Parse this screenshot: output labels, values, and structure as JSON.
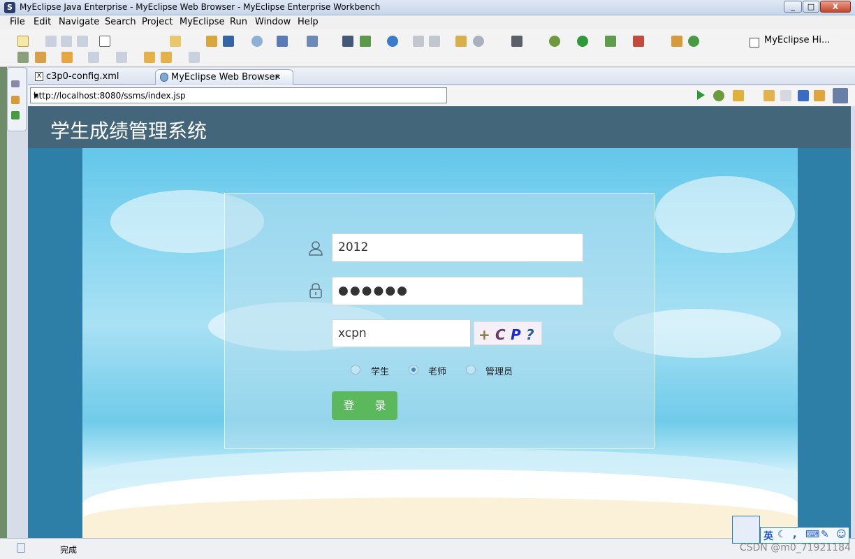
{
  "window": {
    "title": "MyEclipse Java Enterprise - MyEclipse Web Browser - MyEclipse Enterprise Workbench",
    "min": "_",
    "max": "□",
    "close": "X"
  },
  "menu": [
    "File",
    "Edit",
    "Navigate",
    "Search",
    "Project",
    "MyEclipse",
    "Run",
    "Window",
    "Help"
  ],
  "perspective": {
    "label": "MyEclipse Hi..."
  },
  "tabs": [
    {
      "label": "c3p0-config.xml",
      "icon": "xml-file-icon"
    },
    {
      "label": "MyEclipse Web Browser",
      "icon": "globe-icon",
      "close": "✕"
    }
  ],
  "browser": {
    "url": "http://localhost:8080/ssms/index.jsp"
  },
  "page": {
    "title": "学生成绩管理系统",
    "username": "2012",
    "password": "●●●●●●",
    "captcha_input": "xcpn",
    "captcha_chars": [
      "+",
      "C",
      "P",
      "?"
    ],
    "roles": [
      {
        "label": "学生",
        "checked": false
      },
      {
        "label": "老师",
        "checked": true
      },
      {
        "label": "管理员",
        "checked": false
      }
    ],
    "login": "登 录",
    "colors": {
      "header": "#44667a",
      "login": "#5cb85c",
      "page_bg": "#2e7fa8"
    }
  },
  "status": {
    "text": "完成",
    "watermark": "CSDN @m0_71921184"
  },
  "ime": {
    "lang": "英"
  }
}
